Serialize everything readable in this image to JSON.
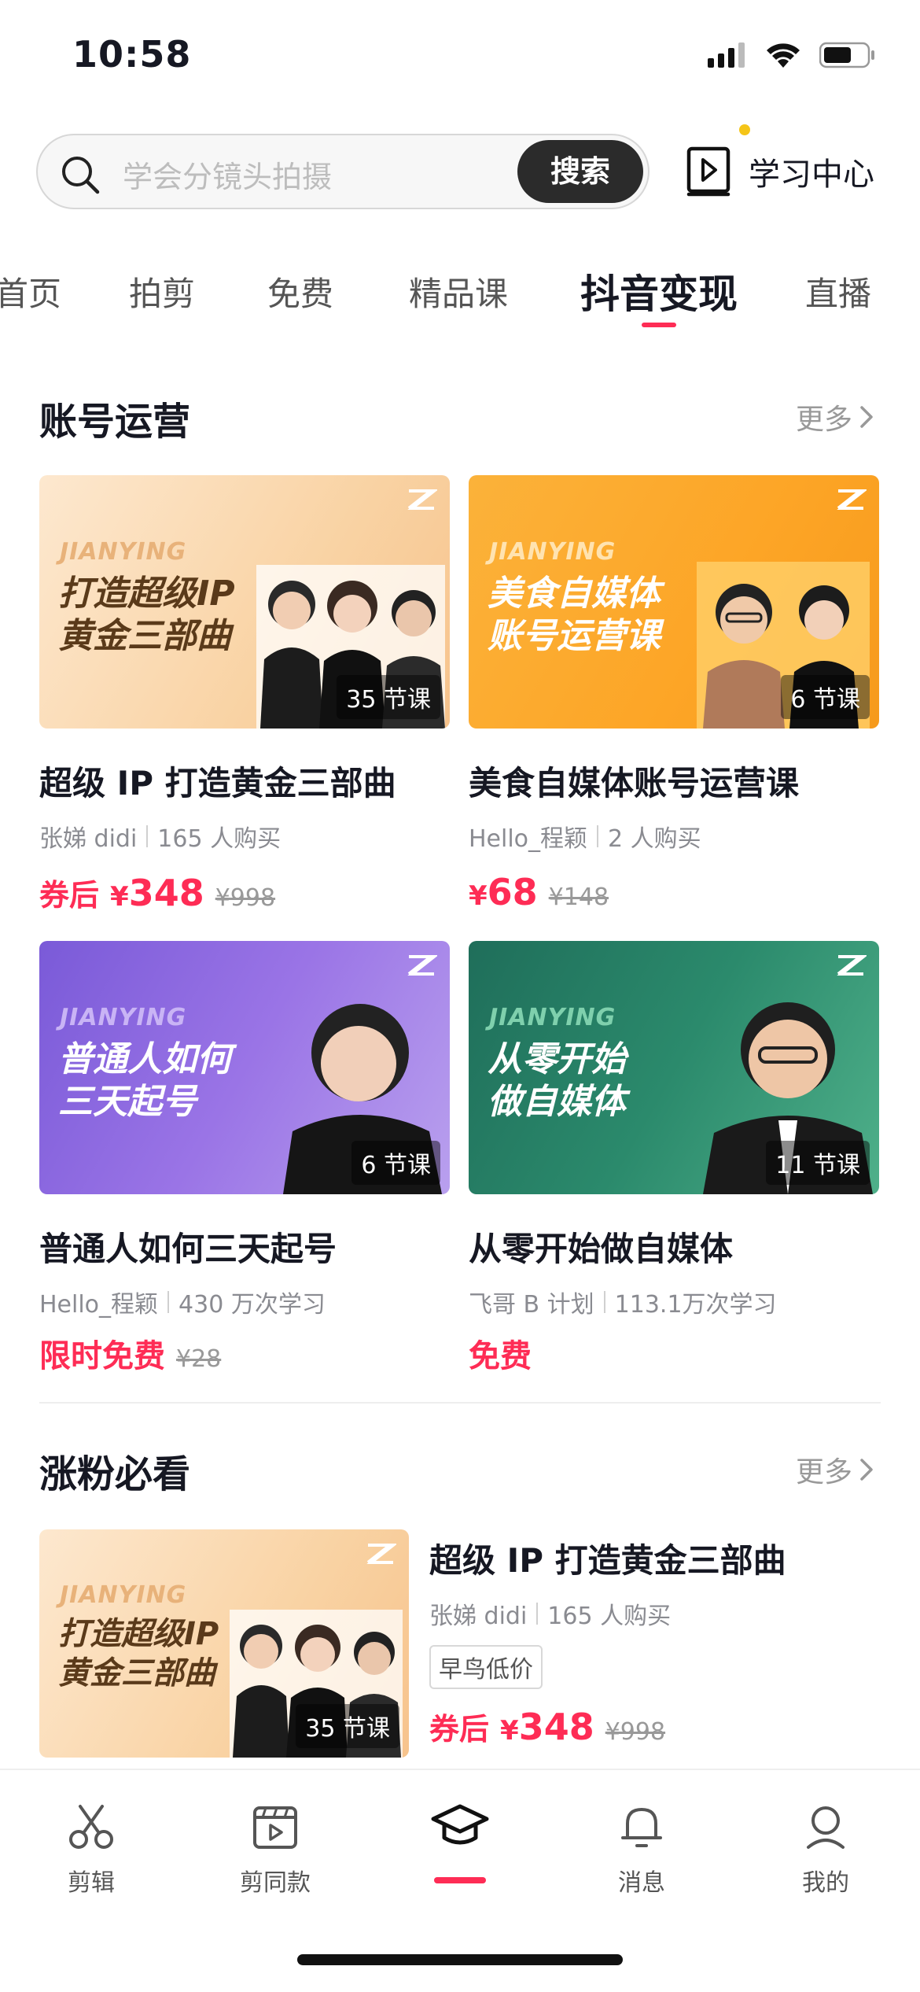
{
  "status_bar": {
    "time": "10:58"
  },
  "search": {
    "placeholder": "学会分镜头拍摄",
    "button": "搜索"
  },
  "learning_center": {
    "label": "学习中心"
  },
  "tabs": [
    {
      "label": "首页"
    },
    {
      "label": "拍剪"
    },
    {
      "label": "免费"
    },
    {
      "label": "精品课"
    },
    {
      "label": "抖音变现",
      "active": true
    },
    {
      "label": "直播"
    }
  ],
  "section_account": {
    "title": "账号运营",
    "more": "更多",
    "cards": [
      {
        "brand": "JIANYING",
        "headline": "打造超级IP\n黄金三部曲",
        "lessons": "35 节课",
        "title": "超级 IP 打造黄金三部曲",
        "author": "张娣 didi",
        "stat": "165 人购买",
        "coupon": "券后",
        "price": "348",
        "currency": "¥",
        "original": "¥998"
      },
      {
        "brand": "JIANYING",
        "headline": "美食自媒体\n账号运营课",
        "lessons": "6 节课",
        "title": "美食自媒体账号运营课",
        "author": "Hello_程颖",
        "stat": "2 人购买",
        "price": "68",
        "currency": "¥",
        "original": "¥148"
      },
      {
        "brand": "JIANYING",
        "headline": "普通人如何\n三天起号",
        "lessons": "6 节课",
        "title": "普通人如何三天起号",
        "author": "Hello_程颖",
        "stat": "430 万次学习",
        "free_label": "限时免费",
        "original": "¥28"
      },
      {
        "brand": "JIANYING",
        "headline": "从零开始\n做自媒体",
        "lessons": "11 节课",
        "title": "从零开始做自媒体",
        "author": "飞哥 B 计划",
        "stat": "113.1万次学习",
        "free_label": "免费"
      }
    ]
  },
  "section_fans": {
    "title": "涨粉必看",
    "more": "更多",
    "item": {
      "brand": "JIANYING",
      "headline": "打造超级IP\n黄金三部曲",
      "lessons": "35 节课",
      "title": "超级 IP 打造黄金三部曲",
      "author": "张娣 didi",
      "stat": "165 人购买",
      "tag": "早鸟低价",
      "coupon": "券后",
      "currency": "¥",
      "price": "348",
      "original": "¥998"
    }
  },
  "bottom_nav": [
    {
      "label": "剪辑",
      "icon": "scissors-icon"
    },
    {
      "label": "剪同款",
      "icon": "clapper-icon"
    },
    {
      "label": "",
      "icon": "graduation-cap-icon",
      "active": true
    },
    {
      "label": "消息",
      "icon": "bell-icon"
    },
    {
      "label": "我的",
      "icon": "user-icon"
    }
  ],
  "colors": {
    "accent": "#fe2c55",
    "text": "#161823",
    "muted": "#8a8b91"
  }
}
